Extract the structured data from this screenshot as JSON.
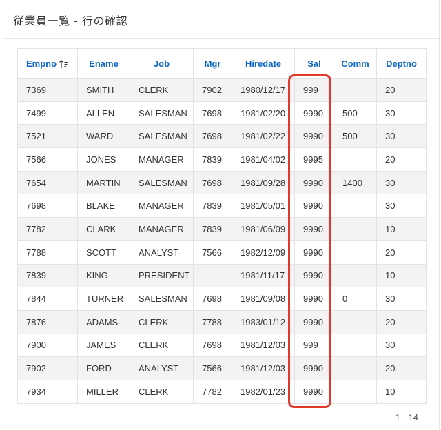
{
  "page": {
    "title": "従業員一覧 - 行の確認",
    "pagination": "1 - 14"
  },
  "table": {
    "columns": [
      "Empno",
      "Ename",
      "Job",
      "Mgr",
      "Hiredate",
      "Sal",
      "Comm",
      "Deptno"
    ],
    "sort_icon": "sort-ascending-icon",
    "rows": [
      [
        "7369",
        "SMITH",
        "CLERK",
        "7902",
        "1980/12/17",
        "999",
        "",
        "20"
      ],
      [
        "7499",
        "ALLEN",
        "SALESMAN",
        "7698",
        "1981/02/20",
        "9990",
        "500",
        "30"
      ],
      [
        "7521",
        "WARD",
        "SALESMAN",
        "7698",
        "1981/02/22",
        "9990",
        "500",
        "30"
      ],
      [
        "7566",
        "JONES",
        "MANAGER",
        "7839",
        "1981/04/02",
        "9995",
        "",
        "20"
      ],
      [
        "7654",
        "MARTIN",
        "SALESMAN",
        "7698",
        "1981/09/28",
        "9990",
        "1400",
        "30"
      ],
      [
        "7698",
        "BLAKE",
        "MANAGER",
        "7839",
        "1981/05/01",
        "9990",
        "",
        "30"
      ],
      [
        "7782",
        "CLARK",
        "MANAGER",
        "7839",
        "1981/06/09",
        "9990",
        "",
        "10"
      ],
      [
        "7788",
        "SCOTT",
        "ANALYST",
        "7566",
        "1982/12/09",
        "9990",
        "",
        "20"
      ],
      [
        "7839",
        "KING",
        "PRESIDENT",
        "",
        "1981/11/17",
        "9990",
        "",
        "10"
      ],
      [
        "7844",
        "TURNER",
        "SALESMAN",
        "7698",
        "1981/09/08",
        "9990",
        "0",
        "30"
      ],
      [
        "7876",
        "ADAMS",
        "CLERK",
        "7788",
        "1983/01/12",
        "9990",
        "",
        "20"
      ],
      [
        "7900",
        "JAMES",
        "CLERK",
        "7698",
        "1981/12/03",
        "999",
        "",
        "30"
      ],
      [
        "7902",
        "FORD",
        "ANALYST",
        "7566",
        "1981/12/03",
        "9990",
        "",
        "20"
      ],
      [
        "7934",
        "MILLER",
        "CLERK",
        "7782",
        "1982/01/23",
        "9990",
        "",
        "10"
      ]
    ]
  },
  "colors": {
    "header_text": "#0b66c3",
    "highlight": "#e0382a",
    "row_alt": "#f3f3f3"
  }
}
